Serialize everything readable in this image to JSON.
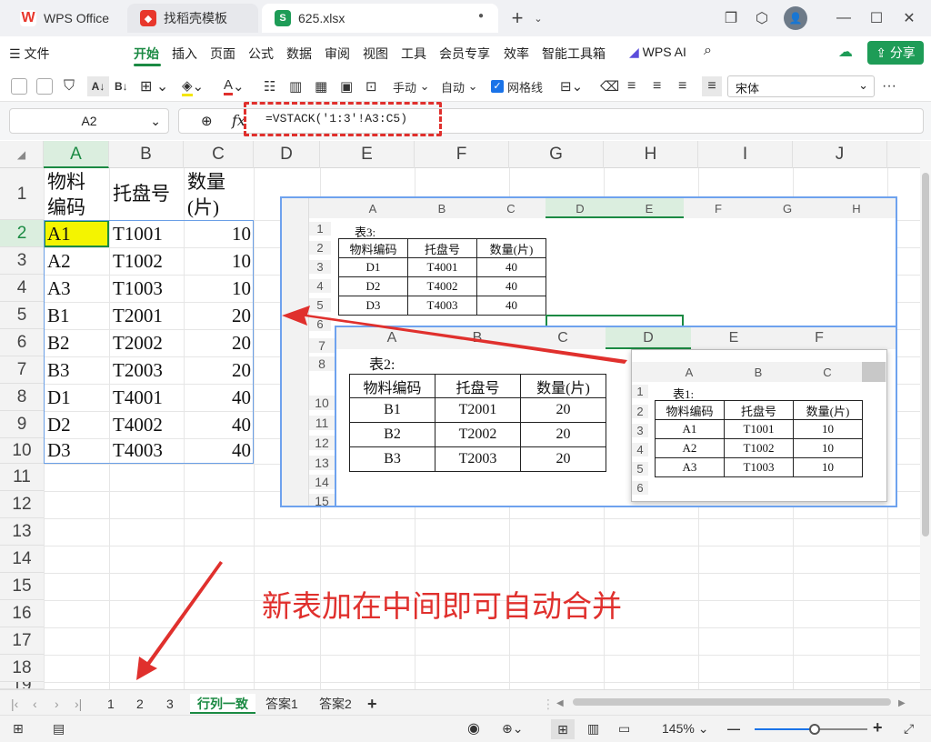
{
  "titlebar": {
    "tabs": [
      {
        "label": "WPS Office",
        "icon": "wps-logo-icon",
        "color": "#e8372c"
      },
      {
        "label": "找稻壳模板",
        "icon": "docer-icon",
        "color": "#e8372c"
      },
      {
        "label": "625.xlsx",
        "icon": "spreadsheet-s-icon",
        "color": "#1e9c57"
      }
    ]
  },
  "menu": {
    "file": "文件",
    "items": [
      "开始",
      "插入",
      "页面",
      "公式",
      "数据",
      "审阅",
      "视图",
      "工具",
      "会员专享",
      "效率",
      "智能工具箱"
    ],
    "wps_ai": "WPS AI",
    "share": "分享"
  },
  "toolbar": {
    "manual": "手动",
    "auto": "自动",
    "gridlines": "网格线",
    "font": "宋体"
  },
  "formula": {
    "namebox": "A2",
    "fx": "fx",
    "text": "=VSTACK('1:3'!A3:C5)"
  },
  "grid": {
    "columns": [
      "A",
      "B",
      "C",
      "D",
      "E",
      "F",
      "G",
      "H",
      "I",
      "J"
    ],
    "rows": [
      "1",
      "2",
      "3",
      "4",
      "5",
      "6",
      "7",
      "8",
      "9",
      "10",
      "11",
      "12",
      "13",
      "14",
      "15",
      "16",
      "17",
      "18",
      "19"
    ],
    "header": [
      "物料",
      "编码",
      "托盘号",
      "数量",
      "(片)"
    ],
    "data": [
      [
        "A1",
        "T1001",
        "10"
      ],
      [
        "A2",
        "T1002",
        "10"
      ],
      [
        "A3",
        "T1003",
        "10"
      ],
      [
        "B1",
        "T2001",
        "20"
      ],
      [
        "B2",
        "T2002",
        "20"
      ],
      [
        "B3",
        "T2003",
        "20"
      ],
      [
        "D1",
        "T4001",
        "40"
      ],
      [
        "D2",
        "T4002",
        "40"
      ],
      [
        "D3",
        "T4003",
        "40"
      ]
    ]
  },
  "embedded": {
    "sheet3": {
      "cols": [
        "A",
        "B",
        "C",
        "D",
        "E",
        "F",
        "G",
        "H"
      ],
      "rows": [
        "1",
        "2",
        "3",
        "4",
        "5",
        "6"
      ],
      "title": "表3:",
      "header": [
        "物料编码",
        "托盘号",
        "数量(片)"
      ],
      "data": [
        [
          "D1",
          "T4001",
          "40"
        ],
        [
          "D2",
          "T4002",
          "40"
        ],
        [
          "D3",
          "T4003",
          "40"
        ]
      ]
    },
    "sheet2": {
      "cols": [
        "A",
        "B",
        "C",
        "D",
        "E",
        "F"
      ],
      "rows": [
        "7",
        "8",
        "10",
        "11",
        "12",
        "13",
        "14",
        "15"
      ],
      "title": "表2:",
      "header": [
        "物料编码",
        "托盘号",
        "数量(片)"
      ],
      "data": [
        [
          "B1",
          "T2001",
          "20"
        ],
        [
          "B2",
          "T2002",
          "20"
        ],
        [
          "B3",
          "T2003",
          "20"
        ]
      ]
    },
    "sheet1": {
      "cols": [
        "A",
        "B",
        "C"
      ],
      "rows": [
        "1",
        "2",
        "3",
        "4",
        "5",
        "6"
      ],
      "title": "表1:",
      "header": [
        "物料编码",
        "托盘号",
        "数量(片)"
      ],
      "data": [
        [
          "A1",
          "T1001",
          "10"
        ],
        [
          "A2",
          "T1002",
          "10"
        ],
        [
          "A3",
          "T1003",
          "10"
        ]
      ]
    }
  },
  "annotation": "新表加在中间即可自动合并",
  "sheets": [
    "1",
    "2",
    "3",
    "行列一致",
    "答案1",
    "答案2"
  ],
  "status": {
    "zoom": "145%"
  },
  "colors": {
    "accent": "#1b8a43",
    "annotation": "#e0302d",
    "highlight": "#f4f400"
  }
}
